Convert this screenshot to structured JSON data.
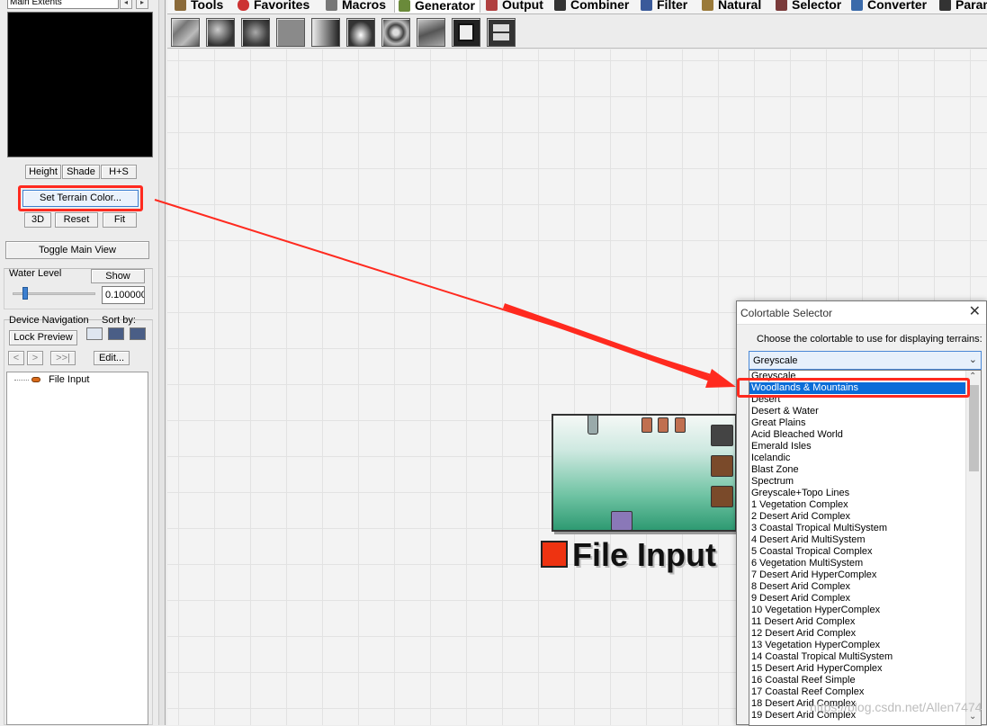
{
  "left_panel": {
    "extents_select": "Main Extents",
    "view_buttons": [
      "Height",
      "Shade",
      "H+S"
    ],
    "set_terrain_color": "Set Terrain Color...",
    "preview_buttons": [
      "3D",
      "Reset",
      "Fit"
    ],
    "toggle_main_view": "Toggle Main View",
    "water_level_label": "Water Level",
    "show_button": "Show",
    "water_level_value": "0.100000",
    "water_level_fraction": 0.13,
    "device_navigation_label": "Device Navigation",
    "sort_by_label": "Sort by:",
    "lock_preview": "Lock Preview",
    "nav_buttons": [
      "<",
      ">",
      ">>|"
    ],
    "edit_button": "Edit...",
    "tree_items": [
      "File Input"
    ]
  },
  "tabs": [
    {
      "label": "Tools",
      "icon": "tools-icon",
      "color": "#8a6a3a"
    },
    {
      "label": "Favorites",
      "icon": "heart-icon",
      "color": "#cc3333"
    },
    {
      "label": "Macros",
      "icon": "macro-icon",
      "color": "#555555"
    },
    {
      "label": "Generator",
      "icon": "generator-icon",
      "color": "#6a8a3a",
      "active": true
    },
    {
      "label": "Output",
      "icon": "output-icon",
      "color": "#b04040"
    },
    {
      "label": "Combiner",
      "icon": "combiner-icon",
      "color": "#333333"
    },
    {
      "label": "Filter",
      "icon": "filter-icon",
      "color": "#3a5a9a"
    },
    {
      "label": "Natural",
      "icon": "natural-icon",
      "color": "#9a7a3a"
    },
    {
      "label": "Selector",
      "icon": "selector-icon",
      "color": "#7a3a3a"
    },
    {
      "label": "Converter",
      "icon": "converter-icon",
      "color": "#3a6aaa"
    },
    {
      "label": "Param",
      "icon": "param-icon",
      "color": "#333333"
    }
  ],
  "toolbar_tools": [
    "advanced-perlin-icon",
    "voronoi-icon",
    "rock-noise-icon",
    "constant-icon",
    "gradient-icon",
    "radial-icon",
    "spot-icon",
    "fractal-icon",
    "file-input-icon",
    "tiled-input-icon"
  ],
  "node": {
    "caption": "File Input",
    "color": "#ee3311"
  },
  "dialog": {
    "title": "Colortable Selector",
    "close": "✕",
    "prompt": "Choose the colortable to use for displaying terrains:",
    "combo_value": "Greyscale",
    "options": [
      "Greyscale",
      "Woodlands & Mountains",
      "Desert",
      "Desert & Water",
      "Great Plains",
      "Acid Bleached World",
      "Emerald Isles",
      "Icelandic",
      "Blast Zone",
      "Spectrum",
      "Greyscale+Topo Lines",
      "1 Vegetation Complex",
      "2 Desert Arid Complex",
      "3 Coastal Tropical MultiSystem",
      "4 Desert Arid MultiSystem",
      "5 Coastal Tropical Complex",
      "6 Vegetation MultiSystem",
      "7 Desert Arid HyperComplex",
      "8 Desert Arid Complex",
      "9 Desert Arid Complex",
      "10 Vegetation HyperComplex",
      "11 Desert Arid Complex",
      "12 Desert Arid Complex",
      "13 Vegetation HyperComplex",
      "14 Coastal Tropical MultiSystem",
      "15 Desert Arid HyperComplex",
      "16 Coastal Reef Simple",
      "17 Coastal Reef Complex",
      "18 Desert Arid Complex",
      "19 Desert Arid Complex"
    ],
    "selected_index": 1
  },
  "annotation_color": "#ff2a1f",
  "watermark": "https://blog.csdn.net/Allen7474"
}
